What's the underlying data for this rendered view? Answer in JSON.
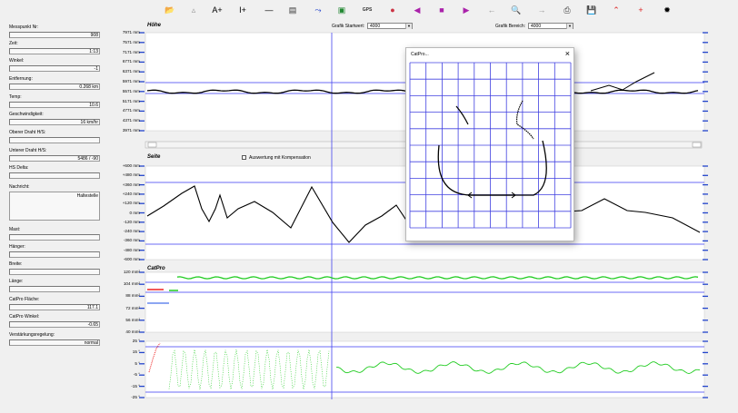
{
  "toolbar": {
    "buttons": [
      {
        "name": "open-icon",
        "glyph": "📂",
        "color": "#c9a227"
      },
      {
        "name": "triangle-icon",
        "glyph": "▵",
        "color": "#999999"
      },
      {
        "name": "a-plus-icon",
        "glyph": "A+",
        "color": "#000000"
      },
      {
        "name": "i-plus-icon",
        "glyph": "I+",
        "color": "#000000"
      },
      {
        "name": "minus-icon",
        "glyph": "—",
        "color": "#000000"
      },
      {
        "name": "document-icon",
        "glyph": "▤",
        "color": "#333333"
      },
      {
        "name": "curve-icon",
        "glyph": "⤳",
        "color": "#2244cc"
      },
      {
        "name": "save-disk-icon",
        "glyph": "▣",
        "color": "#228833"
      },
      {
        "name": "gps-icon",
        "glyph": "GPS",
        "color": "#333333"
      },
      {
        "name": "palette-icon",
        "glyph": "●",
        "color": "#cc3344"
      },
      {
        "name": "previous-icon",
        "glyph": "◀",
        "color": "#aa22aa"
      },
      {
        "name": "stop-icon",
        "glyph": "■",
        "color": "#aa22aa"
      },
      {
        "name": "next-icon",
        "glyph": "▶",
        "color": "#aa22aa"
      },
      {
        "name": "back-arrow-icon",
        "glyph": "←",
        "color": "#999999"
      },
      {
        "name": "zoom-icon",
        "glyph": "🔍",
        "color": "#333333"
      },
      {
        "name": "forward-arrow-icon",
        "glyph": "→",
        "color": "#999999"
      },
      {
        "name": "print-icon",
        "glyph": "⎙",
        "color": "#333333"
      },
      {
        "name": "floppy-icon",
        "glyph": "💾",
        "color": "#333333"
      },
      {
        "name": "peak-icon",
        "glyph": "⌃",
        "color": "#dd2222"
      },
      {
        "name": "crosshair-icon",
        "glyph": "+",
        "color": "#dd2222"
      },
      {
        "name": "target-icon",
        "glyph": "✹",
        "color": "#000000"
      }
    ]
  },
  "left_panel": {
    "fields": [
      {
        "label": "Messpunkt Nr:",
        "value": "908"
      },
      {
        "label": "Zeit:",
        "value": "1:13"
      },
      {
        "label": "Winkel:",
        "value": "-1"
      },
      {
        "label": "Entfernung:",
        "value": "0.268 km"
      },
      {
        "label": "Temp:",
        "value": "10.6"
      },
      {
        "label": "Geschwindigkeit:",
        "value": "16 km/hr"
      },
      {
        "label": "Oberer Draht H/S:",
        "value": ""
      },
      {
        "label": "Unterer Draht H/S:",
        "value": "5486 / -90"
      },
      {
        "label": "HS Delta:",
        "value": ""
      }
    ],
    "message_label": "Nachricht:",
    "message_value": "Haltestelle",
    "fields2": [
      {
        "label": "Mast:",
        "value": ""
      },
      {
        "label": "Hänger:",
        "value": ""
      },
      {
        "label": "Breite:",
        "value": ""
      },
      {
        "label": "Länge:",
        "value": ""
      },
      {
        "label": "CatPro Fläche:",
        "value": "117.1"
      },
      {
        "label": "CatPro Winkel:",
        "value": "-0.65"
      },
      {
        "label": "Verstärkungsregelung:",
        "value": "normal"
      }
    ]
  },
  "controls": {
    "start_label": "Grafik Startwert:",
    "start_value": "4000",
    "range_label": "Grafik Bereich:",
    "range_value": "4000",
    "compensation_label": "Auswertung mit Kompensation"
  },
  "panels": {
    "hoehe": {
      "title": "Höhe",
      "ticks": [
        "7971 mm",
        "7571 mm",
        "7171 mm",
        "6771 mm",
        "6371 mm",
        "5971 mm",
        "5571 mm",
        "5171 mm",
        "4771 mm",
        "4371 mm",
        "3971 mm"
      ]
    },
    "seite": {
      "title": "Seite",
      "ticks": [
        "+600 mm",
        "+480 mm",
        "+360 mm",
        "+240 mm",
        "+120 mm",
        "0 mm",
        "-120 mm",
        "-240 mm",
        "-360 mm",
        "-480 mm",
        "-600 mm"
      ]
    },
    "catpro": {
      "title": "CatPro",
      "ticks": [
        "120 mm²",
        "104 mm²",
        "88 mm²",
        "72 mm²",
        "56 mm²",
        "40 mm²"
      ]
    },
    "winkel": {
      "ticks": [
        "25 °",
        "15 °",
        "5 °",
        "-5 °",
        "-15 °",
        "-25 °"
      ]
    }
  },
  "popup": {
    "title": "CatPro..."
  },
  "colors": {
    "blue_line": "#3a3af0",
    "black_trace": "#000000",
    "green_trace": "#22cc22",
    "red_trace": "#ee2222",
    "grid": "#4040e0"
  }
}
